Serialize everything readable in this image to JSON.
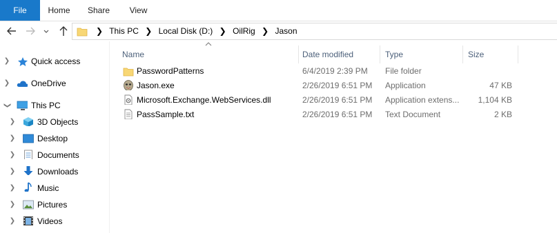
{
  "ribbon": {
    "file": "File",
    "home": "Home",
    "share": "Share",
    "view": "View"
  },
  "address": {
    "crumbs": [
      "This PC",
      "Local Disk (D:)",
      "OilRig",
      "Jason"
    ]
  },
  "nav": {
    "quick_access": "Quick access",
    "onedrive": "OneDrive",
    "this_pc": "This PC",
    "children": [
      "3D Objects",
      "Desktop",
      "Documents",
      "Downloads",
      "Music",
      "Pictures",
      "Videos"
    ]
  },
  "columns": {
    "name": "Name",
    "date": "Date modified",
    "type": "Type",
    "size": "Size"
  },
  "files": [
    {
      "name": "PasswordPatterns",
      "date": "6/4/2019 2:39 PM",
      "type": "File folder",
      "size": "",
      "icon": "folder-icon"
    },
    {
      "name": "Jason.exe",
      "date": "2/26/2019 6:51 PM",
      "type": "Application",
      "size": "47 KB",
      "icon": "app-mask-icon"
    },
    {
      "name": "Microsoft.Exchange.WebServices.dll",
      "date": "2/26/2019 6:51 PM",
      "type": "Application extens...",
      "size": "1,104 KB",
      "icon": "dll-file-icon"
    },
    {
      "name": "PassSample.txt",
      "date": "2/26/2019 6:51 PM",
      "type": "Text Document",
      "size": "2 KB",
      "icon": "text-file-icon"
    }
  ]
}
